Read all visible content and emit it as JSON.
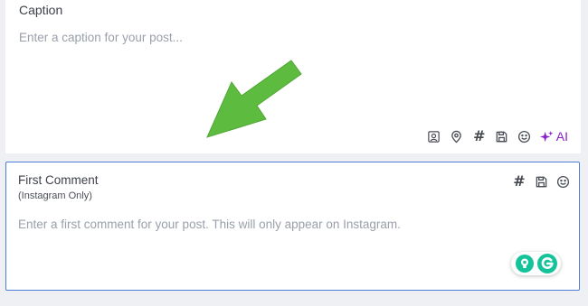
{
  "caption": {
    "label": "Caption",
    "placeholder": "Enter a caption for your post...",
    "toolbar": {
      "hashtag_label": "#",
      "ai_label": "AI",
      "icons": [
        "photo-icon",
        "location-pin-icon",
        "hashtag-icon",
        "save-icon",
        "emoji-icon",
        "ai-sparkle-icon"
      ]
    }
  },
  "first_comment": {
    "label": "First Comment",
    "sublabel": "(Instagram Only)",
    "placeholder": "Enter a first comment for your post. This will only appear on Instagram.",
    "toolbar": {
      "hashtag_label": "#",
      "icons": [
        "hashtag-icon",
        "save-icon",
        "emoji-icon"
      ]
    }
  },
  "colors": {
    "accent_border": "#4c7ed6",
    "ai_purple": "#8a1fc7",
    "arrow_green": "#5dbb3f",
    "grammarly_green": "#15c39a",
    "background": "#eef0f4"
  }
}
